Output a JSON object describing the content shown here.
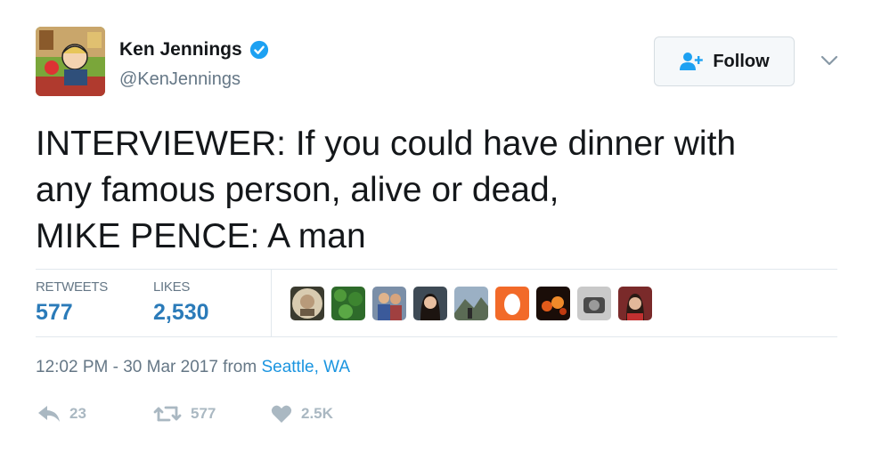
{
  "author": {
    "name": "Ken Jennings",
    "handle": "@KenJennings",
    "verified": true
  },
  "follow_button": {
    "label": "Follow",
    "icon": "follow-user-icon"
  },
  "tweet": {
    "lines": [
      "INTERVIEWER: If you could have dinner with",
      "any famous person, alive or dead,",
      "MIKE PENCE: A man"
    ]
  },
  "stats": {
    "retweets_label": "RETWEETS",
    "retweets_value": "577",
    "likes_label": "LIKES",
    "likes_value": "2,530"
  },
  "likers_count": 9,
  "meta": {
    "timestamp": "12:02 PM - 30 Mar 2017 from ",
    "location": "Seattle, WA"
  },
  "actions": {
    "reply_count": "23",
    "retweet_count": "577",
    "like_count": "2.5K"
  },
  "colors": {
    "link": "#1b95e0",
    "stat_value": "#2b7bb9",
    "muted": "#657786",
    "action_gray": "#aab8c2",
    "verified": "#1da1f2"
  }
}
